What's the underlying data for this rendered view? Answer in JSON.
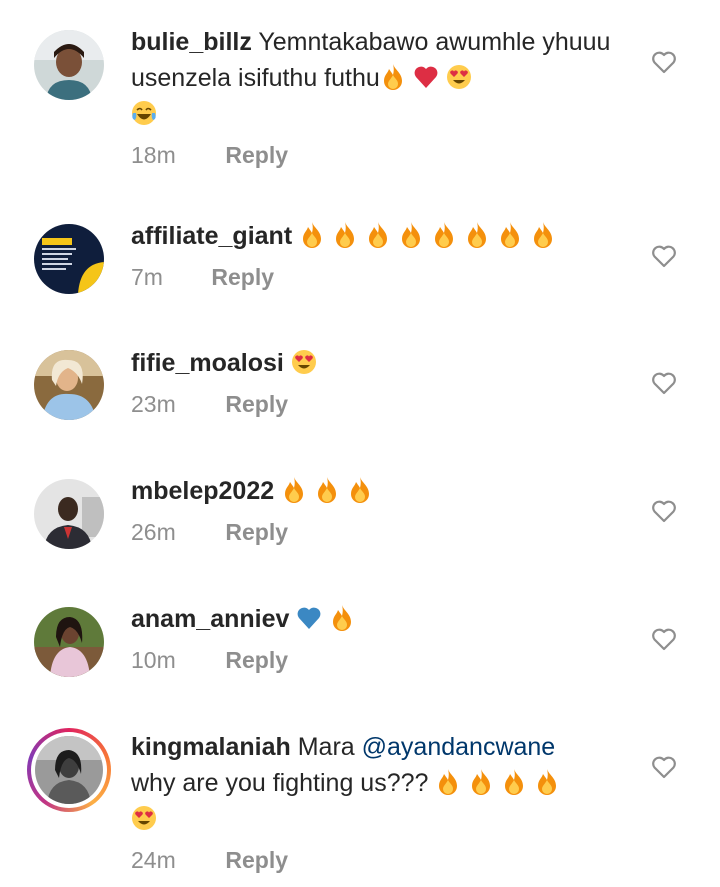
{
  "icons": {
    "like": "heart-outline-icon",
    "fire": "fire-emoji",
    "red_heart": "red-heart-emoji",
    "heart_eyes": "heart-eyes-emoji",
    "joy": "tears-of-joy-emoji",
    "blue_heart": "blue-heart-emoji"
  },
  "colors": {
    "username": "#262626",
    "meta": "#8e8e8e",
    "mention": "#00376b"
  },
  "reply_label": "Reply",
  "comments": [
    {
      "username": "bulie_billz",
      "text": "Yemntakabawo awumhle yhuuu usenzela isifuthu futhu",
      "emojis": [
        "fire",
        "red_heart",
        "heart_eyes",
        "joy"
      ],
      "time": "18m",
      "reply": "Reply"
    },
    {
      "username": "affiliate_giant",
      "text": "",
      "emojis": [
        "fire",
        "fire",
        "fire",
        "fire",
        "fire",
        "fire",
        "fire",
        "fire"
      ],
      "time": "7m",
      "reply": "Reply"
    },
    {
      "username": "fifie_moalosi",
      "text": "",
      "emojis": [
        "heart_eyes"
      ],
      "time": "23m",
      "reply": "Reply"
    },
    {
      "username": "mbelep2022",
      "text": "",
      "emojis": [
        "fire",
        "fire",
        "fire"
      ],
      "time": "26m",
      "reply": "Reply"
    },
    {
      "username": "anam_anniev",
      "text": "",
      "emojis": [
        "blue_heart",
        "fire"
      ],
      "time": "10m",
      "reply": "Reply"
    },
    {
      "username": "kingmalaniah",
      "text_before": "Mara",
      "mention": "@ayandancwane",
      "text_after": "why are you fighting us???",
      "emojis": [
        "fire",
        "fire",
        "fire",
        "fire",
        "heart_eyes"
      ],
      "time": "24m",
      "reply": "Reply"
    }
  ]
}
